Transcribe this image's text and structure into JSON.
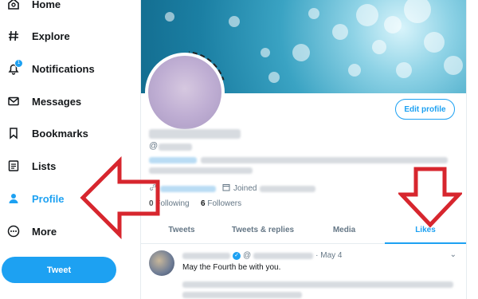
{
  "nav": {
    "items": [
      {
        "label": "Home",
        "icon": "home-icon"
      },
      {
        "label": "Explore",
        "icon": "hashtag-icon"
      },
      {
        "label": "Notifications",
        "icon": "bell-icon",
        "badge": "1"
      },
      {
        "label": "Messages",
        "icon": "envelope-icon"
      },
      {
        "label": "Bookmarks",
        "icon": "bookmark-icon"
      },
      {
        "label": "Lists",
        "icon": "list-icon"
      },
      {
        "label": "Profile",
        "icon": "person-icon",
        "active": true
      },
      {
        "label": "More",
        "icon": "more-circle-icon"
      }
    ],
    "tweet_label": "Tweet"
  },
  "profile": {
    "edit_label": "Edit profile",
    "handle_prefix": "@",
    "joined_label": "Joined",
    "following_count": "0",
    "following_label": "Following",
    "followers_count": "6",
    "followers_label": "Followers"
  },
  "tabs": [
    "Tweets",
    "Tweets & replies",
    "Media",
    "Likes"
  ],
  "active_tab": "Likes",
  "tweet": {
    "handle_prefix": "@",
    "date": "· May 4",
    "text": "May the Fourth be with you."
  },
  "colors": {
    "accent": "#1da1f2",
    "annotation_arrow": "#d7262e"
  }
}
